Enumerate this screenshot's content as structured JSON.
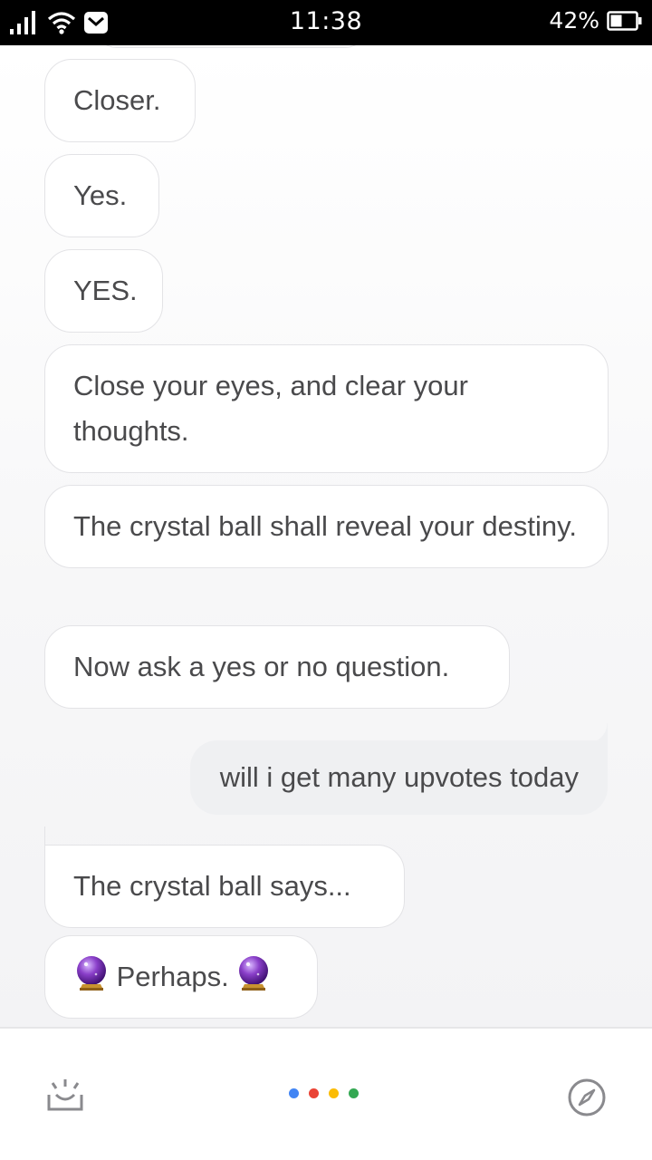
{
  "status_bar": {
    "time": "11:38",
    "battery_percent": "42%",
    "icons": [
      "signal-icon",
      "wifi-icon",
      "mail-icon",
      "battery-icon"
    ]
  },
  "chat": {
    "messages": [
      {
        "sender": "assistant",
        "text": "Closer."
      },
      {
        "sender": "assistant",
        "text": "Yes."
      },
      {
        "sender": "assistant",
        "text": "YES."
      },
      {
        "sender": "assistant",
        "text": "Close your eyes, and clear your thoughts."
      },
      {
        "sender": "assistant",
        "text": "The crystal ball shall reveal your destiny."
      },
      {
        "sender": "assistant",
        "text": "Now ask a yes or no question."
      },
      {
        "sender": "user",
        "text": "will i get many upvotes today"
      },
      {
        "sender": "assistant",
        "text": "The crystal ball says..."
      },
      {
        "sender": "assistant",
        "text": "Perhaps.",
        "icons": [
          "crystal-ball-icon",
          "crystal-ball-icon"
        ]
      }
    ]
  },
  "bottom_bar": {
    "left_icon": "updates-tray-icon",
    "right_icon": "compass-icon",
    "assistant_dots": [
      "#4285f4",
      "#ea4335",
      "#fbbc05",
      "#34a853"
    ]
  }
}
